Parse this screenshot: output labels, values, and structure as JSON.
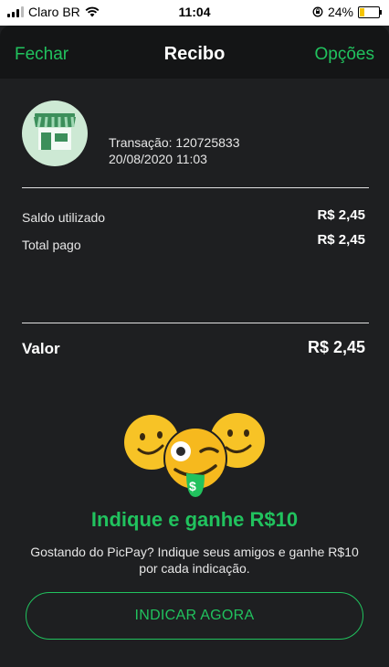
{
  "status_bar": {
    "carrier": "Claro BR",
    "time": "11:04",
    "battery_percent": "24%",
    "battery_level": 0.24
  },
  "nav": {
    "left": "Fechar",
    "title": "Recibo",
    "right": "Opções"
  },
  "transaction": {
    "id_text": "Transação: 120725833",
    "date_text": "20/08/2020 11:03"
  },
  "rows": [
    {
      "label": "Saldo utilizado",
      "value": "R$ 2,45"
    },
    {
      "label": "Total pago",
      "value": "R$ 2,45"
    }
  ],
  "total": {
    "label": "Valor",
    "value": "R$  2,45"
  },
  "promo": {
    "title": "Indique e ganhe R$10",
    "text": "Gostando do PicPay? Indique seus amigos e ganhe R$10 por cada indicação.",
    "button": "INDICAR AGORA"
  },
  "colors": {
    "accent": "#21c25e",
    "background": "#1e1f21",
    "nav_background": "#141516"
  },
  "icons": [
    "signal-icon",
    "wifi-icon",
    "orientation-lock-icon",
    "battery-icon",
    "store-icon",
    "emoji-illustration",
    "dollar-icon"
  ]
}
